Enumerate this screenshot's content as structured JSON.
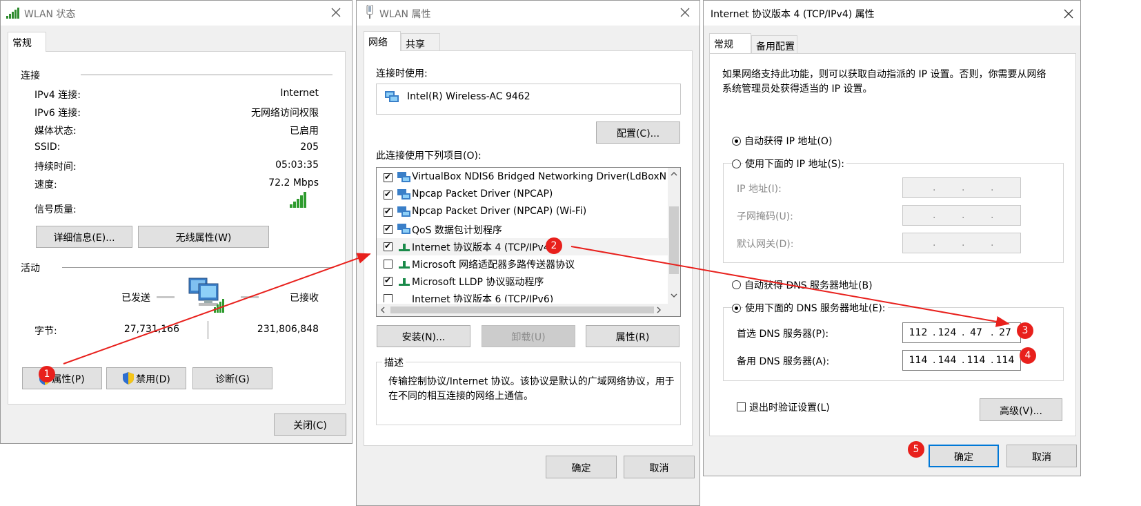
{
  "status_dialog": {
    "title": "WLAN 状态",
    "tab": "常规",
    "section_connection": "连接",
    "rows": [
      {
        "label": "IPv4 连接:",
        "value": "Internet"
      },
      {
        "label": "IPv6 连接:",
        "value": "无网络访问权限"
      },
      {
        "label": "媒体状态:",
        "value": "已启用"
      },
      {
        "label": "SSID:",
        "value": "205"
      },
      {
        "label": "持续时间:",
        "value": "05:03:35"
      },
      {
        "label": "速度:",
        "value": "72.2 Mbps"
      }
    ],
    "signal_label": "信号质量:",
    "details_button": "详细信息(E)...",
    "wireless_props_button": "无线属性(W)",
    "section_activity": "活动",
    "sent_label": "已发送",
    "received_label": "已接收",
    "bytes_label": "字节:",
    "bytes_sent": "27,731,166",
    "bytes_received": "231,806,848",
    "properties_button": "属性(P)",
    "disable_button": "禁用(D)",
    "diagnose_button": "诊断(G)",
    "close_button": "关闭(C)"
  },
  "props_dialog": {
    "title": "WLAN 属性",
    "tabs": [
      "网络",
      "共享"
    ],
    "connect_using_label": "连接时使用:",
    "adapter_name": "Intel(R) Wireless-AC 9462",
    "configure_button": "配置(C)...",
    "items_label": "此连接使用下列项目(O):",
    "items": [
      {
        "checked": true,
        "text": "VirtualBox NDIS6 Bridged Networking Driver(LdBoxN"
      },
      {
        "checked": true,
        "text": "Npcap Packet Driver (NPCAP)"
      },
      {
        "checked": true,
        "text": "Npcap Packet Driver (NPCAP) (Wi-Fi)"
      },
      {
        "checked": true,
        "text": "QoS 数据包计划程序"
      },
      {
        "checked": true,
        "text": "Internet 协议版本 4 (TCP/IPv4)"
      },
      {
        "checked": false,
        "text": "Microsoft 网络适配器多路传送器协议"
      },
      {
        "checked": true,
        "text": "Microsoft LLDP 协议驱动程序"
      },
      {
        "checked": false,
        "text": "Internet 协议版本 6 (TCP/IPv6)"
      }
    ],
    "install_button": "安装(N)...",
    "uninstall_button": "卸载(U)",
    "properties_button": "属性(R)",
    "description_label": "描述",
    "description_text": "传输控制协议/Internet 协议。该协议是默认的广域网络协议，用于在不同的相互连接的网络上通信。",
    "ok_button": "确定",
    "cancel_button": "取消"
  },
  "ipv4_dialog": {
    "title": "Internet 协议版本 4 (TCP/IPv4) 属性",
    "tabs": [
      "常规",
      "备用配置"
    ],
    "intro_text": "如果网络支持此功能，则可以获取自动指派的 IP 设置。否则，你需要从网络系统管理员处获得适当的 IP 设置。",
    "auto_ip_label": "自动获得 IP 地址(O)",
    "manual_ip_label": "使用下面的 IP 地址(S):",
    "ip_address_label": "IP 地址(I):",
    "subnet_label": "子网掩码(U):",
    "gateway_label": "默认网关(D):",
    "auto_dns_label": "自动获得 DNS 服务器地址(B)",
    "manual_dns_label": "使用下面的 DNS 服务器地址(E):",
    "preferred_dns_label": "首选 DNS 服务器(P):",
    "preferred_dns": [
      "112",
      "124",
      "47",
      "27"
    ],
    "alternate_dns_label": "备用 DNS 服务器(A):",
    "alternate_dns": [
      "114",
      "144",
      "114",
      "114"
    ],
    "validate_label": "退出时验证设置(L)",
    "advanced_button": "高级(V)...",
    "ok_button": "确定",
    "cancel_button": "取消"
  },
  "badges": [
    "1",
    "2",
    "3",
    "4",
    "5"
  ],
  "colors": {
    "badge": "#e8201c",
    "arrow": "#e8201c",
    "accent": "#0078d7"
  }
}
